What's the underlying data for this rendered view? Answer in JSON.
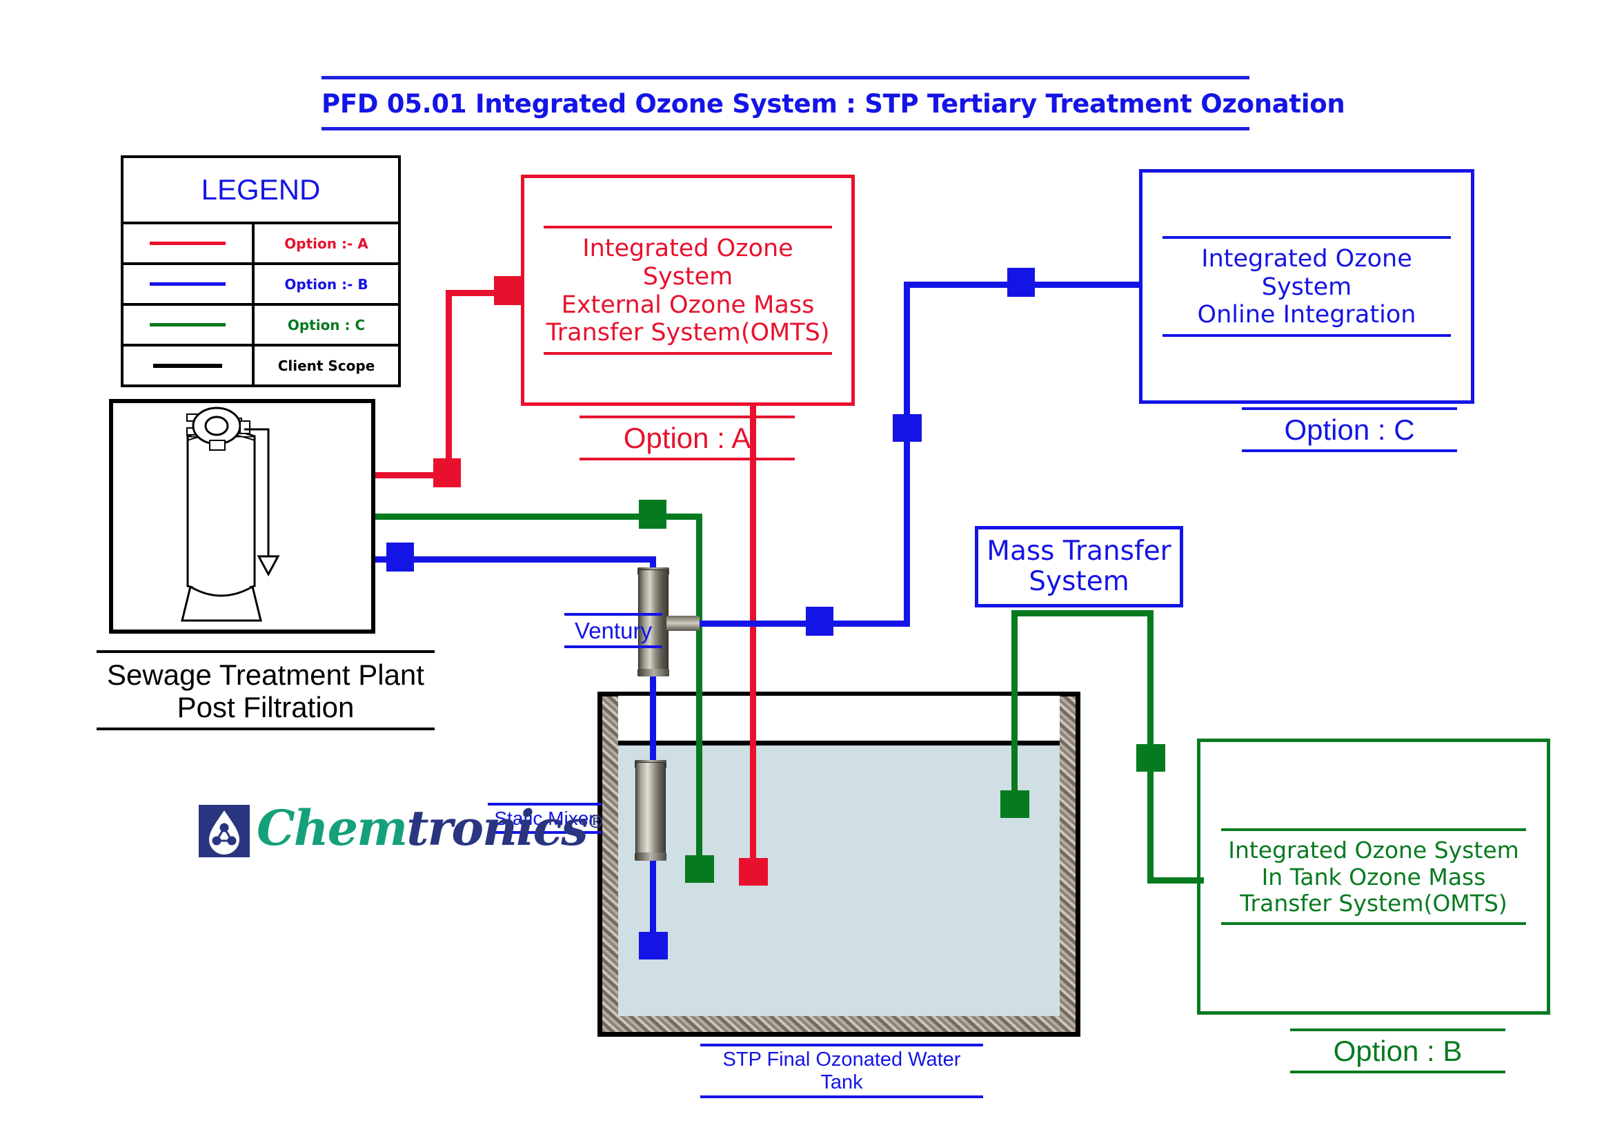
{
  "title": {
    "text": "PFD 05.01 Integrated Ozone System : STP Tertiary Treatment Ozonation",
    "color": "#1414e6"
  },
  "legend": {
    "heading": "LEGEND",
    "rows": [
      {
        "label": "Option :- A",
        "color": "#e8112d"
      },
      {
        "label": "Option :- B",
        "color": "#1414e6"
      },
      {
        "label": "Option : C",
        "color": "#077a20"
      },
      {
        "label": "Client Scope",
        "color": "#000000"
      }
    ]
  },
  "stp": {
    "caption_line1": "Sewage Treatment Plant",
    "caption_line2": "Post Filtration"
  },
  "box_a": {
    "line1": "Integrated Ozone  System",
    "line2": "External Ozone Mass",
    "line3": "Transfer System(OMTS)",
    "option_caption": "Option : A",
    "color": "#e8112d"
  },
  "box_c": {
    "line1": "Integrated Ozone  System",
    "line2": "Online Integration",
    "option_caption": "Option : C",
    "color": "#1414e6"
  },
  "box_b": {
    "line1": "Integrated Ozone System",
    "line2": "In Tank Ozone Mass",
    "line3": "Transfer System(OMTS)",
    "option_caption": "Option : B",
    "color": "#077a20"
  },
  "mass_transfer": {
    "line1": "Mass Transfer",
    "line2": "System",
    "color": "#1414e6"
  },
  "labels": {
    "ventury": "Ventury",
    "static_mixer": "Static Mixer",
    "tank": "STP Final Ozonated Water Tank"
  },
  "logo": {
    "word1": "Chem",
    "word2": "tronics",
    "registered": "®",
    "color1": "#14a07a",
    "color2": "#2a3580"
  },
  "colors": {
    "option_a_red": "#e8112d",
    "option_b_blue": "#1414e6",
    "option_c_green": "#077a20",
    "client_scope_black": "#000000",
    "water": "#cfdfe4"
  }
}
